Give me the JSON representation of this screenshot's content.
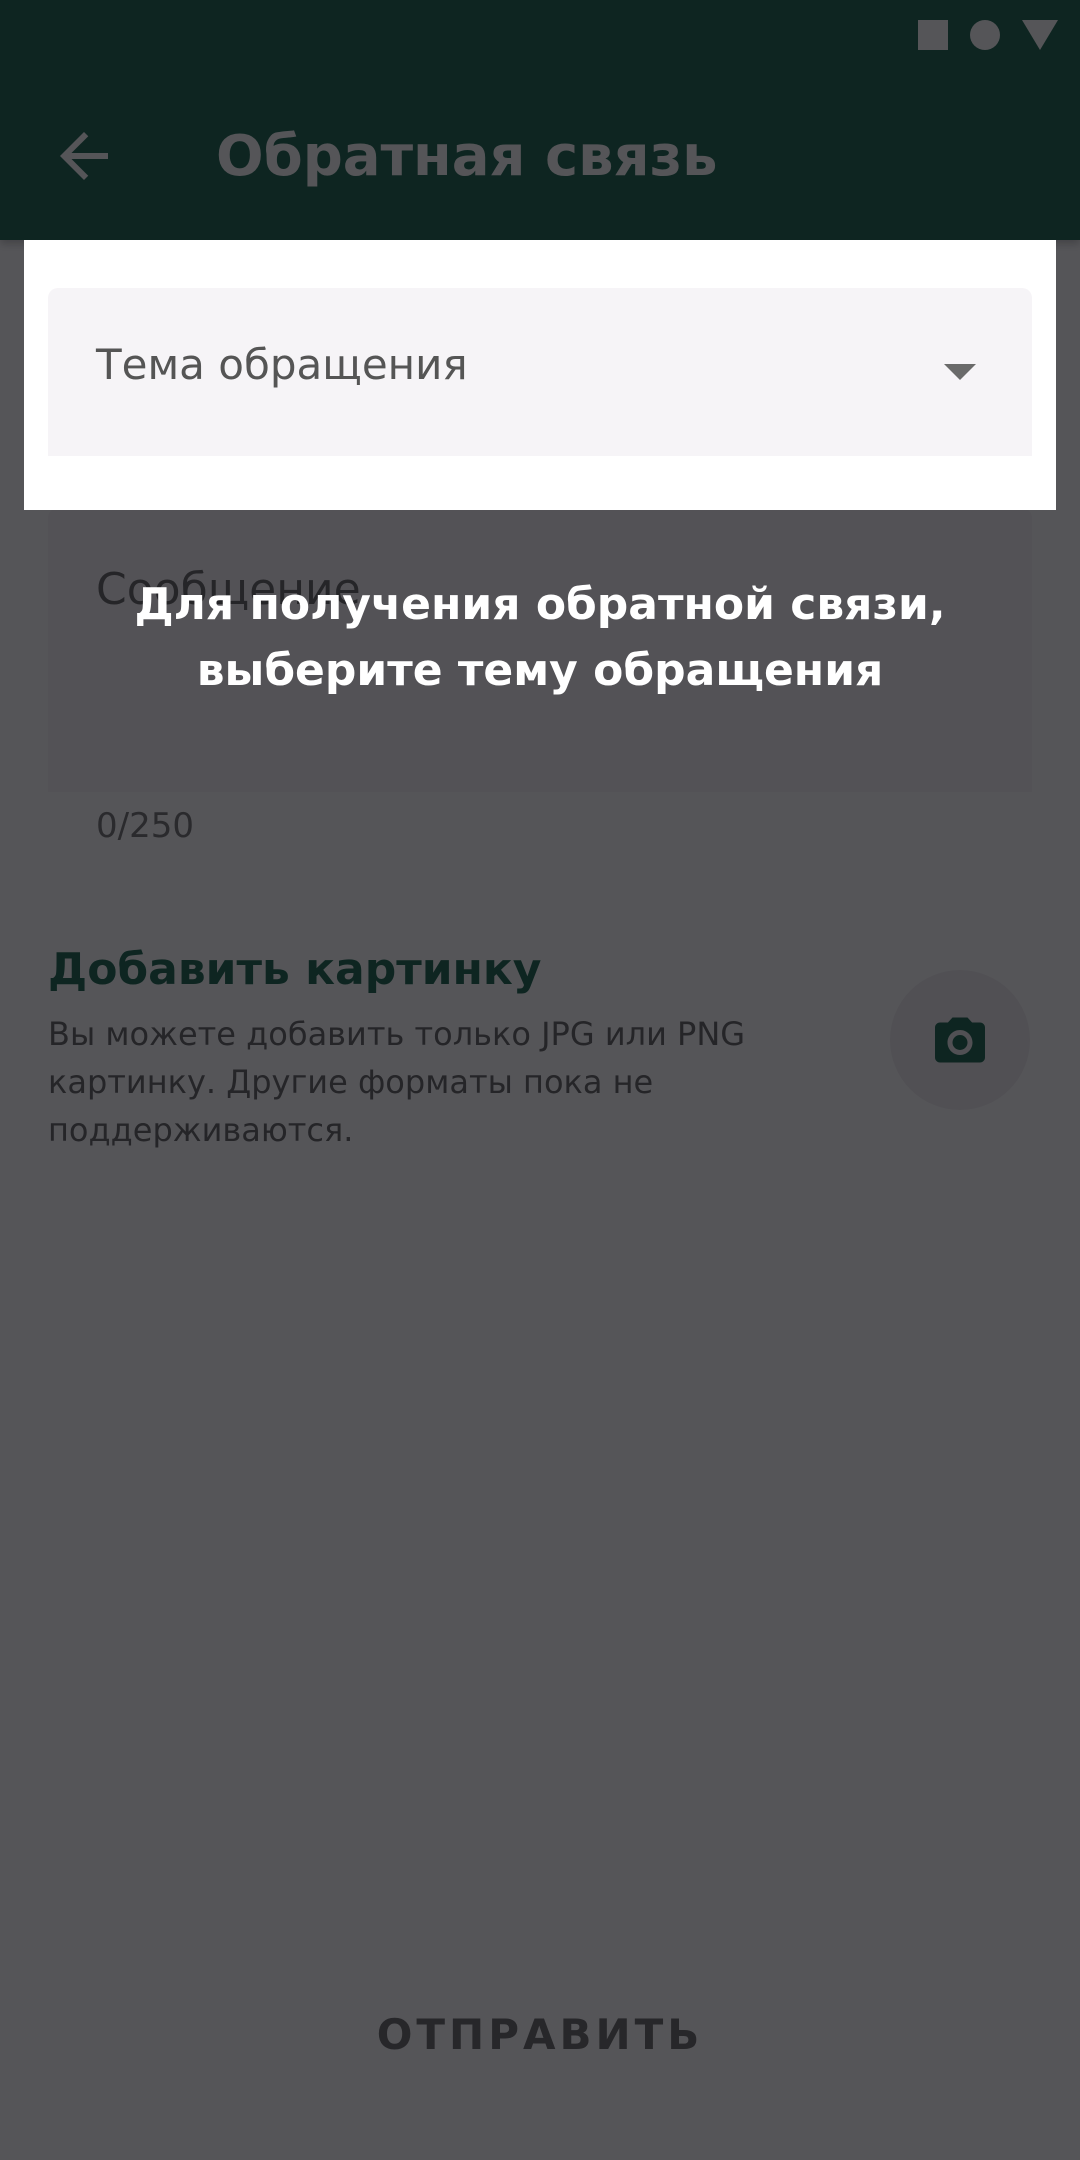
{
  "status_bar": {
    "icons": [
      "square-icon",
      "circle-icon",
      "triangle-icon"
    ]
  },
  "app_bar": {
    "title": "Обратная связь",
    "back_icon": "arrow-back-icon",
    "background": "#03553a"
  },
  "form": {
    "topic_placeholder": "Тема обращения",
    "message_placeholder": "Сообщение",
    "counter": "0/250"
  },
  "attachment": {
    "title": "Добавить картинку",
    "description": "Вы можете добавить только JPG или PNG картинку. Другие форматы пока не поддерживаются.",
    "icon": "camera-icon"
  },
  "actions": {
    "send_label": "ОТПРАВИТЬ"
  },
  "onboarding_hint": {
    "text": "Для получения обратной связи, выберите тему обращения"
  },
  "colors": {
    "accent": "#03553a",
    "overlay": "rgba(20,20,24,0.72)"
  }
}
